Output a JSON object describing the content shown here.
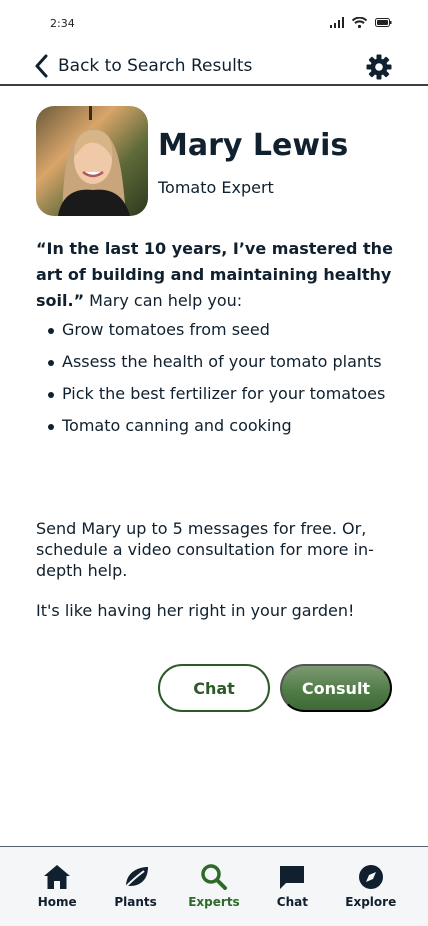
{
  "status_bar": {
    "time": "2:34"
  },
  "nav": {
    "back_label": "Back to Search Results"
  },
  "expert": {
    "name": "Mary Lewis",
    "title": "Tomato Expert"
  },
  "bio": {
    "quote": "“In the last 10 years, I’ve mastered the art of building and maintaining healthy soil.”",
    "lead": " Mary can help you:"
  },
  "skills": [
    "Grow tomatoes from seed",
    "Assess the health of your tomato plants",
    "Pick the best fertilizer for your tomatoes",
    "Tomato canning and cooking"
  ],
  "offer_text": "Send Mary up to 5 messages for free. Or, schedule a video consultation for more in-depth help.",
  "garden_note": "It's like having her right in your garden!",
  "actions": {
    "chat_label": "Chat",
    "consult_label": "Consult"
  },
  "tabs": [
    {
      "label": "Home",
      "icon": "home-icon"
    },
    {
      "label": "Plants",
      "icon": "leaf-icon"
    },
    {
      "label": "Experts",
      "icon": "search-icon",
      "active": true
    },
    {
      "label": "Chat",
      "icon": "chat-bubble-icon"
    },
    {
      "label": "Explore",
      "icon": "compass-icon"
    }
  ],
  "colors": {
    "accent": "#2e6a28",
    "text": "#10202e",
    "consult": "#4e7a45"
  }
}
